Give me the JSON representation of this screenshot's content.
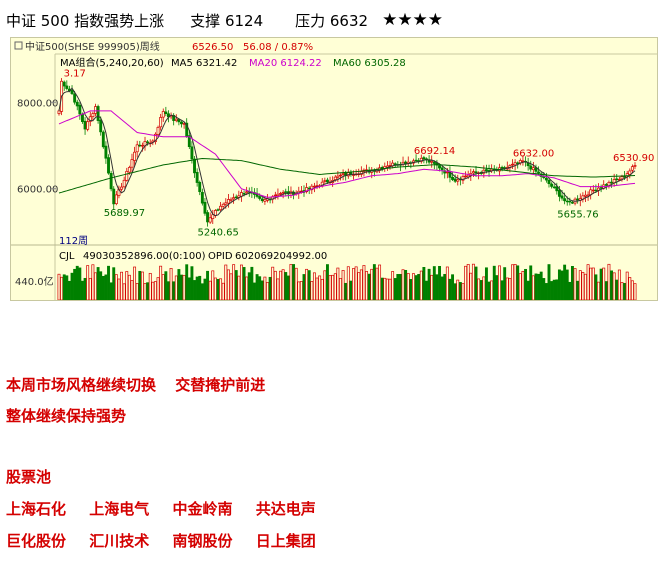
{
  "headline": {
    "title": "中证 500 指数强势上涨",
    "support": "支撑 6124",
    "pressure": "压力 6632",
    "stars": "★★★★"
  },
  "colors": {
    "up": "#d40000",
    "down": "#008000",
    "ma5": "#333333",
    "ma20": "#cc00cc",
    "ma60": "#006600",
    "panel_bg": "#ffffd6",
    "note": "#d40000"
  },
  "chart_data": {
    "type": "candlestick",
    "period": "112周",
    "header": {
      "symbol": "中证500(SHSE 999905)周线",
      "last": "6526.50",
      "change": "56.08 / 0.87%"
    },
    "ma_legend": {
      "group": "MA组合(5,240,20,60)",
      "ma5": "MA5 6321.42",
      "ma20": "MA20 6124.22",
      "ma60": "MA60 6305.28"
    },
    "y_ticks": [
      {
        "value": 8000,
        "label": "8000.00"
      },
      {
        "value": 6000,
        "label": "6000.00"
      }
    ],
    "ylim": [
      4860,
      8700
    ],
    "annotations": [
      {
        "label": "3.17",
        "index": 1,
        "value": 8480
      },
      {
        "label": "5689.97",
        "index": 21,
        "value": 5690
      },
      {
        "label": "5240.65",
        "index": 57,
        "value": 5240
      },
      {
        "label": "6692.14",
        "index": 140,
        "value": 6692
      },
      {
        "label": "6632.00",
        "index": 178,
        "value": 6632
      },
      {
        "label": "5655.76",
        "index": 195,
        "value": 5656
      },
      {
        "label": "6530.90",
        "index": 221,
        "value": 6531
      }
    ],
    "price_keypoints": [
      [
        0,
        7800
      ],
      [
        1,
        8480
      ],
      [
        5,
        8200
      ],
      [
        10,
        7400
      ],
      [
        14,
        7900
      ],
      [
        18,
        6700
      ],
      [
        21,
        5690
      ],
      [
        25,
        6200
      ],
      [
        30,
        7000
      ],
      [
        36,
        7100
      ],
      [
        40,
        7800
      ],
      [
        44,
        7600
      ],
      [
        48,
        7500
      ],
      [
        52,
        6400
      ],
      [
        57,
        5240
      ],
      [
        62,
        5600
      ],
      [
        67,
        5800
      ],
      [
        72,
        5950
      ],
      [
        78,
        5700
      ],
      [
        84,
        5900
      ],
      [
        90,
        5900
      ],
      [
        96,
        6000
      ],
      [
        102,
        6150
      ],
      [
        108,
        6300
      ],
      [
        114,
        6380
      ],
      [
        120,
        6420
      ],
      [
        126,
        6550
      ],
      [
        132,
        6600
      ],
      [
        140,
        6692
      ],
      [
        146,
        6500
      ],
      [
        152,
        6200
      ],
      [
        158,
        6350
      ],
      [
        164,
        6400
      ],
      [
        170,
        6450
      ],
      [
        178,
        6632
      ],
      [
        184,
        6350
      ],
      [
        190,
        6000
      ],
      [
        195,
        5656
      ],
      [
        200,
        5800
      ],
      [
        206,
        6000
      ],
      [
        212,
        6150
      ],
      [
        216,
        6250
      ],
      [
        221,
        6531
      ]
    ],
    "ma20_keypoints": [
      [
        0,
        7500
      ],
      [
        12,
        7800
      ],
      [
        20,
        7800
      ],
      [
        30,
        7300
      ],
      [
        40,
        7200
      ],
      [
        50,
        7200
      ],
      [
        60,
        6800
      ],
      [
        70,
        6000
      ],
      [
        80,
        5800
      ],
      [
        90,
        5850
      ],
      [
        100,
        6050
      ],
      [
        110,
        6150
      ],
      [
        120,
        6300
      ],
      [
        130,
        6350
      ],
      [
        140,
        6450
      ],
      [
        150,
        6400
      ],
      [
        160,
        6300
      ],
      [
        170,
        6300
      ],
      [
        180,
        6350
      ],
      [
        190,
        6250
      ],
      [
        200,
        6050
      ],
      [
        210,
        6050
      ],
      [
        221,
        6124
      ]
    ],
    "ma60_keypoints": [
      [
        0,
        5900
      ],
      [
        20,
        6250
      ],
      [
        40,
        6550
      ],
      [
        55,
        6700
      ],
      [
        70,
        6650
      ],
      [
        85,
        6450
      ],
      [
        100,
        6330
      ],
      [
        115,
        6400
      ],
      [
        130,
        6500
      ],
      [
        145,
        6560
      ],
      [
        160,
        6500
      ],
      [
        175,
        6400
      ],
      [
        190,
        6300
      ],
      [
        205,
        6270
      ],
      [
        221,
        6305
      ]
    ],
    "volume": {
      "label_cjl": "CJL",
      "value": "49030352896.00(0:100)",
      "opid": "OPID",
      "opid_value": "602069204992.00",
      "axis_label": "440.0亿",
      "axis_value": 440
    }
  },
  "notes": {
    "line1_a": "本周市场风格继续切换",
    "line1_b": "交替掩护前进",
    "line2": "整体继续保持强势",
    "pool_title": "股票池",
    "stocks_row1": [
      "上海石化",
      "上海电气",
      "中金岭南",
      "共达电声"
    ],
    "stocks_row2": [
      "巨化股份",
      "汇川技术",
      "南钢股份",
      "日上集团"
    ]
  }
}
